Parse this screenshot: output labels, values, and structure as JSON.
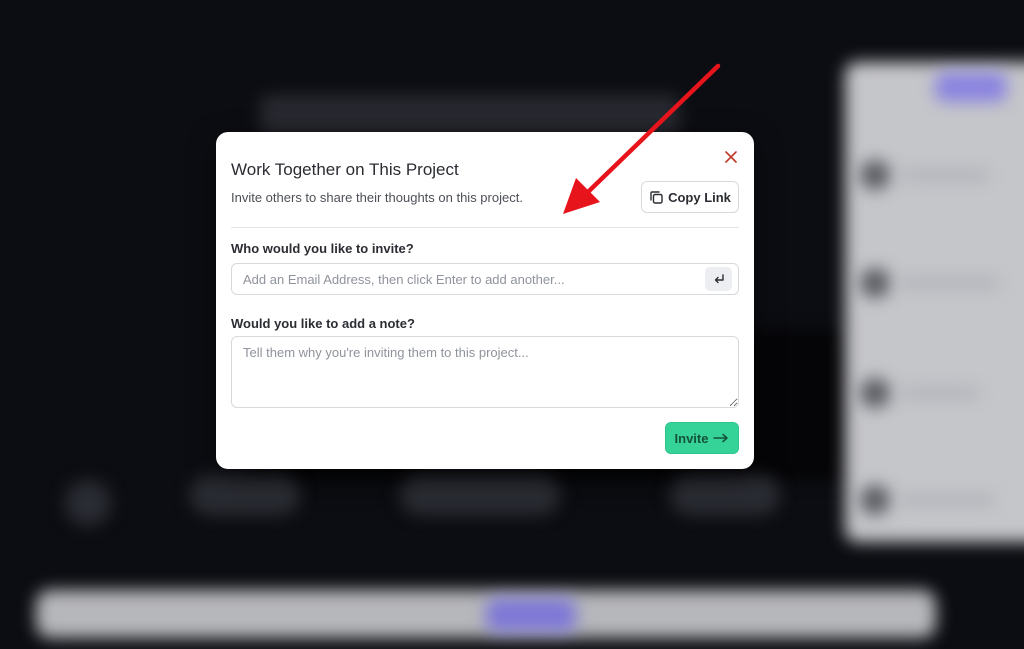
{
  "modal": {
    "title": "Work Together on This Project",
    "subtitle": "Invite others to share their thoughts on this project.",
    "copy_link_label": "Copy Link",
    "invite_label": "Who would you like to invite?",
    "email_placeholder": "Add an Email Address, then click Enter to add another...",
    "note_label": "Would you like to add a note?",
    "note_placeholder": "Tell them why you're inviting them to this project...",
    "invite_button_label": "Invite",
    "icons": {
      "close": "close-icon",
      "copy": "copy-icon",
      "enter": "enter-icon",
      "arrow": "arrow-right-icon"
    }
  },
  "colors": {
    "accent_green": "#36d399",
    "close_red": "#c0392b",
    "annotation_red": "#e8141c",
    "backdrop": "#0c0d12"
  }
}
